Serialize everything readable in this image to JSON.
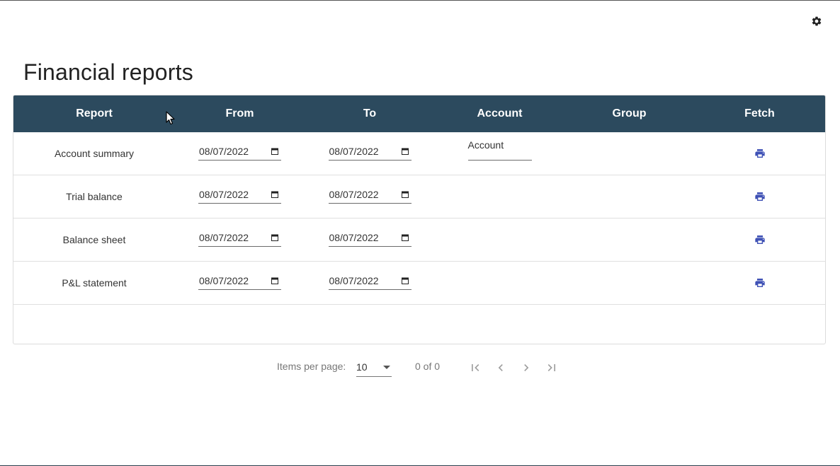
{
  "page": {
    "title": "Financial reports"
  },
  "table": {
    "headers": {
      "report": "Report",
      "from": "From",
      "to": "To",
      "account": "Account",
      "group": "Group",
      "fetch": "Fetch"
    },
    "rows": [
      {
        "report": "Account summary",
        "from": "08/07/2022",
        "to": "08/07/2022",
        "account_placeholder": "Account"
      },
      {
        "report": "Trial balance",
        "from": "08/07/2022",
        "to": "08/07/2022"
      },
      {
        "report": "Balance sheet",
        "from": "08/07/2022",
        "to": "08/07/2022"
      },
      {
        "report": "P&L statement",
        "from": "08/07/2022",
        "to": "08/07/2022"
      }
    ]
  },
  "paginator": {
    "items_per_page_label": "Items per page:",
    "items_per_page_value": "10",
    "range": "0 of 0"
  },
  "colors": {
    "header_bg": "#2c4a5e",
    "print_icon": "#3f51b5"
  },
  "icons": {
    "settings": "gear-icon",
    "fetch": "printer-icon",
    "date": "calendar-icon",
    "first": "first-page-icon",
    "prev": "chevron-left-icon",
    "next": "chevron-right-icon",
    "last": "last-page-icon"
  }
}
